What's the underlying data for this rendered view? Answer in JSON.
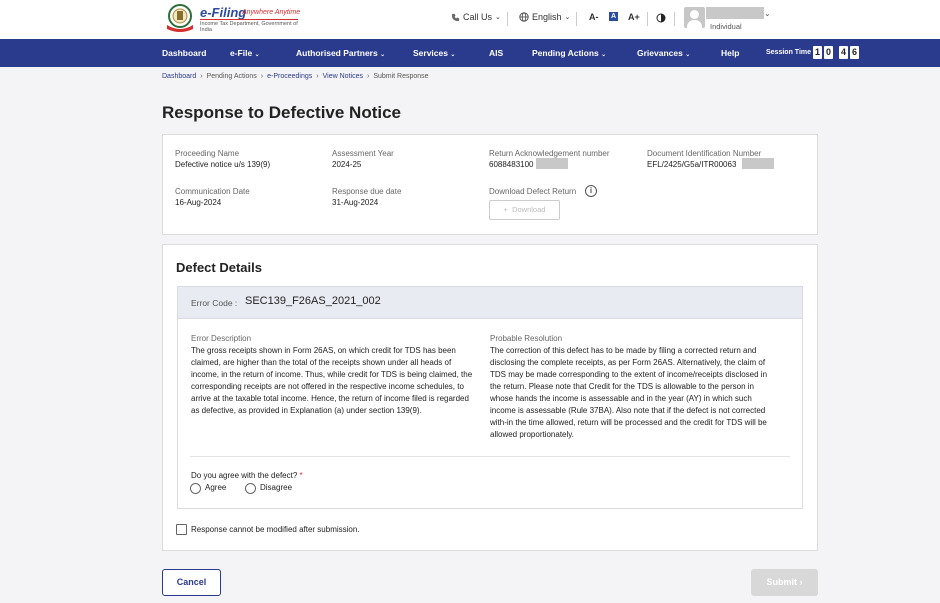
{
  "header": {
    "logo_title": "e-Filing",
    "logo_tagline": "Anywhere Anytime",
    "logo_subtitle": "Income Tax Department, Government of India",
    "call_us": "Call Us",
    "language": "English",
    "font_decrease": "A-",
    "font_normal": "A",
    "font_increase": "A+",
    "user_role": "Individual"
  },
  "nav": {
    "items": [
      "Dashboard",
      "e-File",
      "Authorised Partners",
      "Services",
      "AIS",
      "Pending Actions",
      "Grievances",
      "Help"
    ],
    "session_label": "Session Time",
    "session_digits": [
      "1",
      "0",
      "4",
      "6"
    ]
  },
  "breadcrumb": [
    "Dashboard",
    "Pending Actions",
    "e-Proceedings",
    "View Notices",
    "Submit Response"
  ],
  "page_title": "Response to Defective Notice",
  "notice": {
    "proceeding_name_label": "Proceeding Name",
    "proceeding_name": "Defective notice u/s 139(9)",
    "assessment_year_label": "Assessment Year",
    "assessment_year": "2024-25",
    "ack_label": "Return Acknowledgement number",
    "ack_value": "6088483100",
    "din_label": "Document Identification Number",
    "din_value": "EFL/2425/G5a/ITR00063",
    "comm_date_label": "Communication Date",
    "comm_date": "16-Aug-2024",
    "due_date_label": "Response due date",
    "due_date": "31-Aug-2024",
    "download_label": "Download Defect Return",
    "download_button": "Download"
  },
  "defect": {
    "section_title": "Defect Details",
    "error_code_label": "Error Code :",
    "error_code": "SEC139_F26AS_2021_002",
    "description_label": "Error Description",
    "description_lines": [
      "The gross receipts shown in Form 26AS, on which credit for TDS has been",
      "claimed, are higher than the total of the receipts shown under all heads of",
      "income, in the return of income. Thus, while credit for TDS is being claimed, the",
      "corresponding receipts are not offered in the respective income schedules, to",
      "arrive at the taxable total income. Hence, the return of income filed is regarded",
      "as defective, as provided in Explanation (a) under section 139(9)."
    ],
    "resolution_label": "Probable Resolution",
    "resolution_lines": [
      "The correction of this defect has to be made by filing a corrected return and",
      "disclosing the complete receipts, as per Form 26AS. Alternatively, the claim of",
      "TDS may be made corresponding to the extent of income/receipts disclosed in",
      "the return. Please note that Credit for the TDS is allowable to the person in",
      "whose hands the income is assessable and in the year (AY) in which such",
      "income is assessable (Rule 37BA). Also note that if the defect is not corrected",
      "with-in the time allowed, return will be processed and the credit for TDS will be",
      "allowed proportionately."
    ],
    "agree_question": "Do you agree with the defect?",
    "required_mark": "*",
    "agree_option": "Agree",
    "disagree_option": "Disagree"
  },
  "confirm_checkbox_label": "Response cannot be modified after submission.",
  "actions": {
    "cancel": "Cancel",
    "submit": "Submit"
  },
  "colors": {
    "nav_bg": "#2a3a8c",
    "page_bg": "#f4f4f6",
    "error_header_bg": "#e8ebf2",
    "required": "#d32f2f"
  }
}
